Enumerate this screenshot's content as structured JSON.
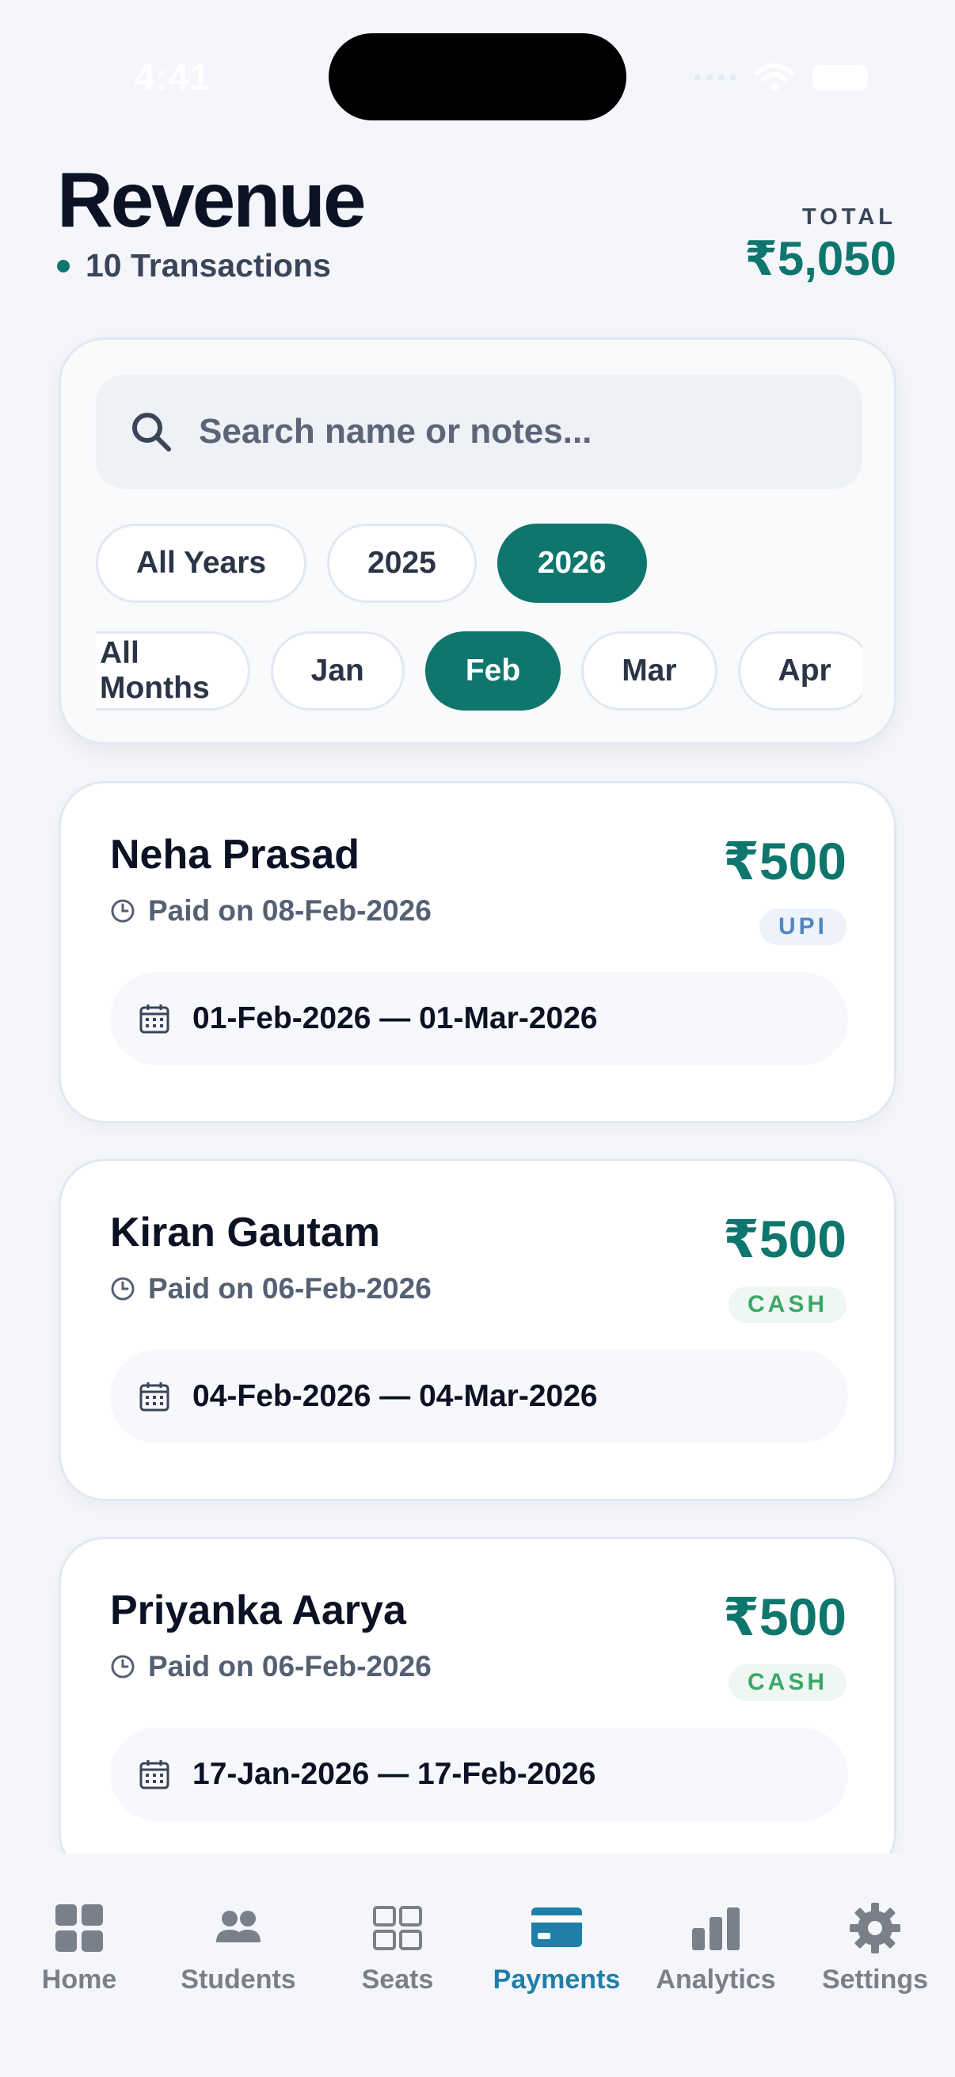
{
  "status_bar": {
    "time": "4:41"
  },
  "header": {
    "title": "Revenue",
    "transactions": "10 Transactions",
    "total_label": "TOTAL",
    "total_value": "₹5,050"
  },
  "search": {
    "placeholder": "Search name or notes..."
  },
  "filters": {
    "years": [
      {
        "label": "All Years",
        "active": false
      },
      {
        "label": "2025",
        "active": false
      },
      {
        "label": "2026",
        "active": true
      }
    ],
    "months": [
      {
        "label": "All Months",
        "active": false
      },
      {
        "label": "Jan",
        "active": false
      },
      {
        "label": "Feb",
        "active": true
      },
      {
        "label": "Mar",
        "active": false
      },
      {
        "label": "Apr",
        "active": false
      }
    ]
  },
  "payments": [
    {
      "name": "Neha Prasad",
      "paid_on": "Paid on 08-Feb-2026",
      "amount": "₹500",
      "method": "UPI",
      "period": "01-Feb-2026 — 01-Mar-2026"
    },
    {
      "name": "Kiran Gautam",
      "paid_on": "Paid on 06-Feb-2026",
      "amount": "₹500",
      "method": "CASH",
      "period": "04-Feb-2026 — 04-Mar-2026"
    },
    {
      "name": "Priyanka Aarya",
      "paid_on": "Paid on 06-Feb-2026",
      "amount": "₹500",
      "method": "CASH",
      "period": "17-Jan-2026 — 17-Feb-2026"
    }
  ],
  "tabs": [
    {
      "label": "Home",
      "icon": "home-grid-icon"
    },
    {
      "label": "Students",
      "icon": "students-icon"
    },
    {
      "label": "Seats",
      "icon": "seats-grid-icon"
    },
    {
      "label": "Payments",
      "icon": "credit-card-icon",
      "active": true
    },
    {
      "label": "Analytics",
      "icon": "bar-chart-icon"
    },
    {
      "label": "Settings",
      "icon": "gear-icon"
    }
  ],
  "colors": {
    "accent": "#0f766e",
    "tab_active": "#1f7fa8",
    "tab_inactive": "#7a8089",
    "upi": "#4f87c4",
    "cash": "#3aa86a"
  }
}
